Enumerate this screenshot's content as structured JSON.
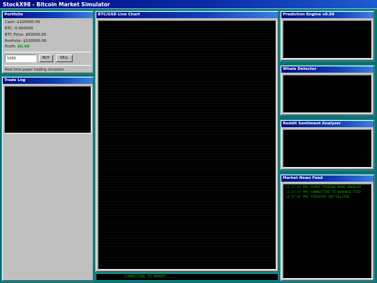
{
  "app": {
    "title": "StockX98 - Bitcoin Market Simulator"
  },
  "portfolio": {
    "title": "Portfolio",
    "cash": "Cash: $100000.00",
    "btc": "BTC: 0.000000",
    "btc_price": "BTC Price: $60000.00",
    "portfolio_value": "Portfolio: $100000.00",
    "profit_label": "Profit: ",
    "profit_value": "$0.00",
    "amount_value": "1000",
    "buy_label": "BUY",
    "sell_label": "SELL",
    "footer": "Real time paper trading simulator."
  },
  "trade_log": {
    "title": "Trade Log"
  },
  "chart": {
    "title": "BTC/USD Live Chart"
  },
  "status": {
    "text": "CONNECTING TO MARKET..."
  },
  "prediction": {
    "title": "Prediction Engine v0.98"
  },
  "whale": {
    "title": "Whale Detector"
  },
  "reddit": {
    "title": "Reddit Sentiment Analyzer"
  },
  "news": {
    "title": "Market News Feed",
    "items": [
      "[2:27:47 PM] PAPER TRADING MODE ENABLED",
      "[2:27:47 PM] CONNECTING TO BINANCE FEED",
      "[2:27:47 PM] STOCKX98 INITIALIZED"
    ]
  },
  "colors": {
    "desktop": "#0a7070",
    "titlebar": "#000a80",
    "profit": "#00a000",
    "terminal_text": "#00b000"
  }
}
